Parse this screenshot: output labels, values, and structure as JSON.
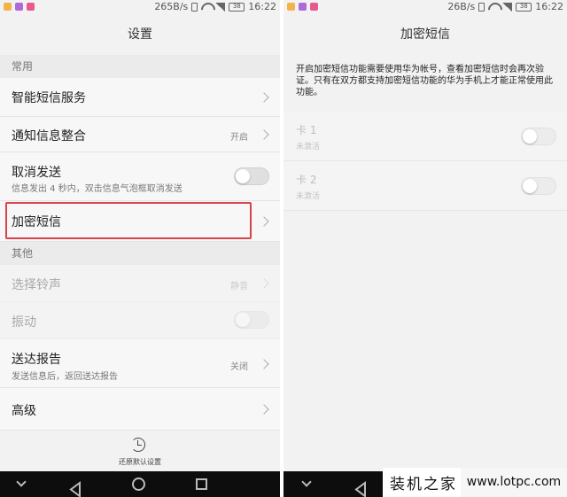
{
  "colors": {
    "accent_red": "#d9434b",
    "notif1": "#f2b34a",
    "notif2": "#b06ad8",
    "notif3": "#e85a8e"
  },
  "left": {
    "status": {
      "speed": "265B/s",
      "battery": "38",
      "time": "16:22"
    },
    "title": "设置",
    "section_common": "常用",
    "items": {
      "smart": {
        "label": "智能短信服务"
      },
      "notify": {
        "label": "通知信息整合",
        "value": "开启"
      },
      "cancel_send": {
        "label": "取消发送",
        "sub": "信息发出 4 秒内，双击信息气泡框取消发送",
        "toggle_on": false
      },
      "encrypted": {
        "label": "加密短信"
      },
      "ringtone": {
        "label": "选择铃声",
        "value": "静音"
      },
      "vibrate": {
        "label": "振动",
        "toggle_on": false
      },
      "report": {
        "label": "送达报告",
        "sub": "发送信息后，返回送达报告",
        "value": "关闭"
      },
      "advanced": {
        "label": "高级"
      }
    },
    "section_other": "其他",
    "restore_label": "还原默认设置"
  },
  "right": {
    "status": {
      "speed": "26B/s",
      "battery": "38",
      "time": "16:22"
    },
    "title": "加密短信",
    "description": "开启加密短信功能需要使用华为帐号，查看加密短信时会再次验证。只有在双方都支持加密短信功能的华为手机上才能正常使用此功能。",
    "cards": [
      {
        "label": "卡 1",
        "status": "未激活",
        "toggle_on": false
      },
      {
        "label": "卡 2",
        "status": "未激活",
        "toggle_on": false
      }
    ]
  },
  "watermark": {
    "cn": "装机之家",
    "url": "www.lotpc.com"
  }
}
